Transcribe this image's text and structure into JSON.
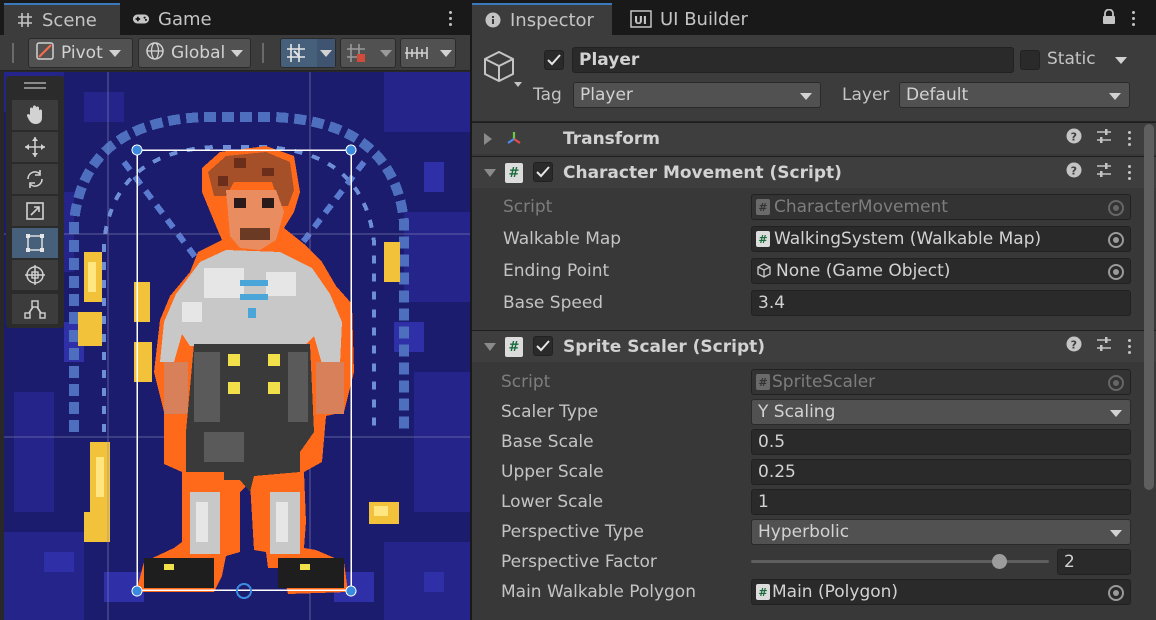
{
  "scene_panel": {
    "tabs": [
      {
        "label": "Scene",
        "icon": "grid-icon"
      },
      {
        "label": "Game",
        "icon": "gamepad-icon"
      }
    ],
    "toolbar": {
      "pivot_label": "Pivot",
      "global_label": "Global"
    },
    "tools": [
      "hand-tool-icon",
      "move-tool-icon",
      "rotate-tool-icon",
      "scale-tool-icon",
      "rect-tool-icon",
      "transform-tool-icon",
      "custom-tool-icon"
    ],
    "active_tool": "rect-tool-icon"
  },
  "inspector": {
    "tabs": [
      {
        "label": "Inspector",
        "icon": "info-icon"
      },
      {
        "label": "UI Builder",
        "icon": "ui-builder-icon"
      }
    ],
    "gameobject": {
      "name": "Player",
      "active": true,
      "static_label": "Static",
      "static": false,
      "tag_label": "Tag",
      "tag_value": "Player",
      "layer_label": "Layer",
      "layer_value": "Default"
    },
    "components": {
      "transform": {
        "title": "Transform"
      },
      "character_movement": {
        "title": "Character Movement (Script)",
        "enabled": true,
        "script_label": "Script",
        "script_value": "CharacterMovement",
        "walkable_map_label": "Walkable Map",
        "walkable_map_value": "WalkingSystem (Walkable Map)",
        "ending_point_label": "Ending Point",
        "ending_point_value": "None (Game Object)",
        "base_speed_label": "Base Speed",
        "base_speed_value": "3.4"
      },
      "sprite_scaler": {
        "title": "Sprite Scaler (Script)",
        "enabled": true,
        "script_label": "Script",
        "script_value": "SpriteScaler",
        "scaler_type_label": "Scaler Type",
        "scaler_type_value": "Y Scaling",
        "base_scale_label": "Base Scale",
        "base_scale_value": "0.5",
        "upper_scale_label": "Upper Scale",
        "upper_scale_value": "0.25",
        "lower_scale_label": "Lower Scale",
        "lower_scale_value": "1",
        "perspective_type_label": "Perspective Type",
        "perspective_type_value": "Hyperbolic",
        "perspective_factor_label": "Perspective Factor",
        "perspective_factor_value": "2",
        "perspective_factor_slider": 0.85,
        "main_polygon_label": "Main Walkable Polygon",
        "main_polygon_value": "Main (Polygon)"
      }
    }
  },
  "colors": {
    "accent": "#3a79bb",
    "selection_outline": "#ff6a1a",
    "scene_bg": "#191966"
  }
}
